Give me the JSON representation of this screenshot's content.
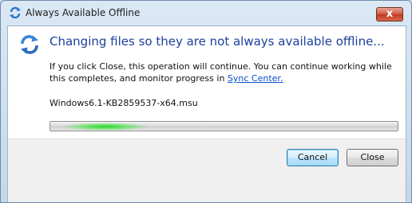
{
  "window": {
    "title": "Always Available Offline",
    "close_glyph": "x"
  },
  "dialog": {
    "heading": "Changing files so they are not always available offline...",
    "description_prefix": "If you click Close, this operation will continue.  You can continue working while this completes, and monitor progress in ",
    "sync_center_link": "Sync Center.",
    "current_file": "Windows6.1-KB2859537-x64.msu",
    "progress_state": "indeterminate"
  },
  "buttons": {
    "cancel_label": "Cancel",
    "close_label": "Close"
  },
  "colors": {
    "heading": "#1b3f9a",
    "link": "#0a50c8",
    "progress_glow": "#2fd32f"
  },
  "icons": {
    "title": "sync-icon",
    "main": "sync-icon"
  }
}
